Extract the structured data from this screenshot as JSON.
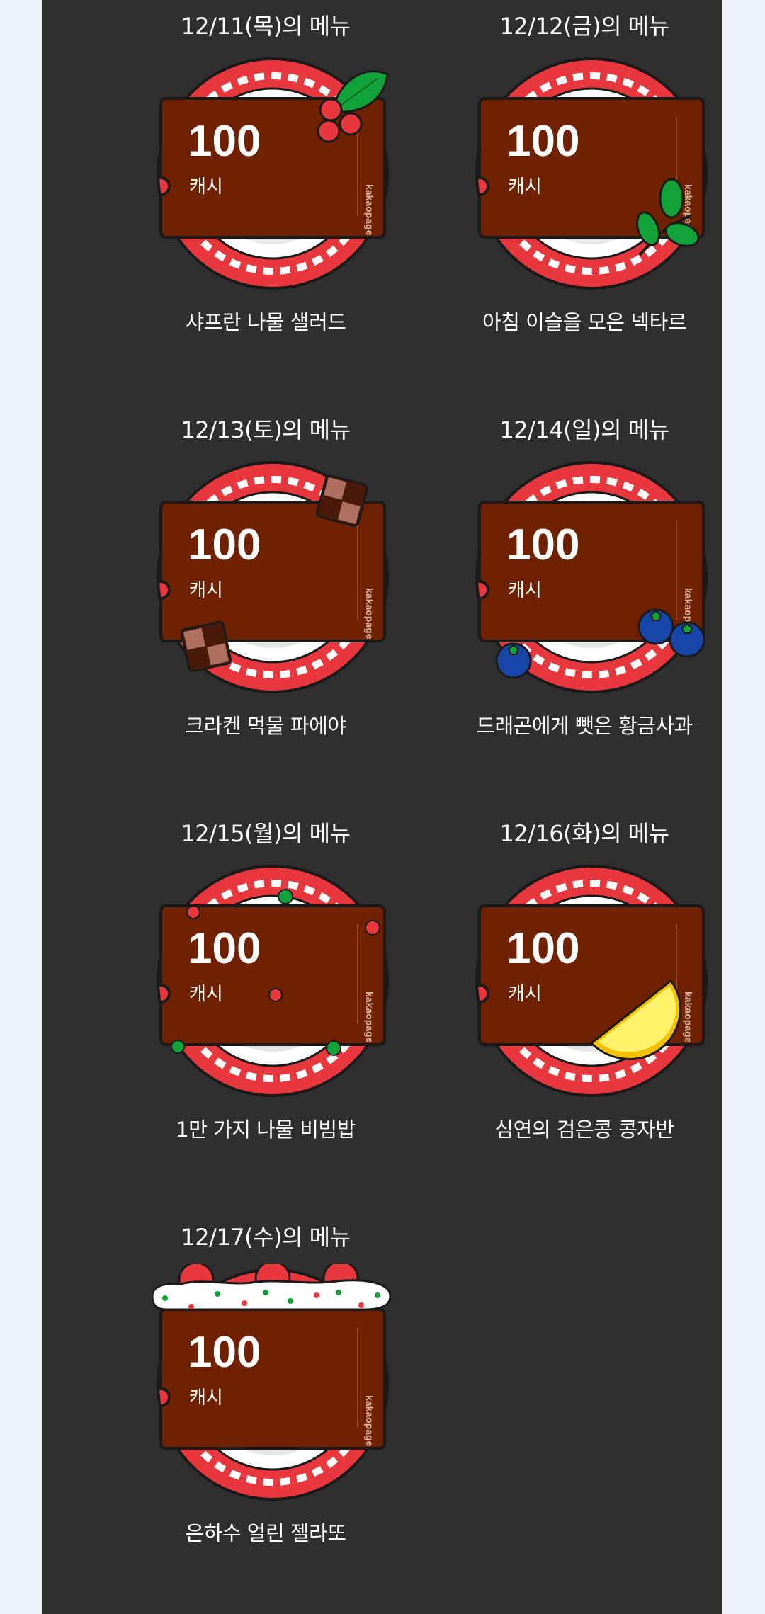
{
  "colors": {
    "page_bg": "#eef0f9",
    "panel_bg": "#2f2f2f",
    "ticket": "#6f2100",
    "plate_red": "#e8383e",
    "plate_white": "#ffffff"
  },
  "cards": [
    {
      "title": "12/11(목)의 메뉴",
      "amount": "100",
      "unit": "캐시",
      "brand": "kakaopage",
      "caption": "샤프란 나물 샐러드",
      "decoration": "holly-icon"
    },
    {
      "title": "12/12(금)의 메뉴",
      "amount": "100",
      "unit": "캐시",
      "brand": "kakaopage",
      "caption": "아침 이슬을 모은 넥타르",
      "decoration": "leaf-sprig-icon"
    },
    {
      "title": "12/13(토)의 메뉴",
      "amount": "100",
      "unit": "캐시",
      "brand": "kakaopage",
      "caption": "크라켄 먹물 파에야",
      "decoration": "chocolate-icon"
    },
    {
      "title": "12/14(일)의 메뉴",
      "amount": "100",
      "unit": "캐시",
      "brand": "kakaopage",
      "caption": "드래곤에게 뺏은 황금사과",
      "decoration": "blueberry-icon"
    },
    {
      "title": "12/15(월)의 메뉴",
      "amount": "100",
      "unit": "캐시",
      "brand": "kakaopage",
      "caption": "1만 가지 나물 비빔밥",
      "decoration": "sprinkles-icon"
    },
    {
      "title": "12/16(화)의 메뉴",
      "amount": "100",
      "unit": "캐시",
      "brand": "kakaopage",
      "caption": "심연의 검은콩 콩자반",
      "decoration": "lemon-slice-icon"
    },
    {
      "title": "12/17(수)의 메뉴",
      "amount": "100",
      "unit": "캐시",
      "brand": "kakaopage",
      "caption": "은하수 얼린 젤라또",
      "decoration": "cream-cherry-icon"
    }
  ]
}
